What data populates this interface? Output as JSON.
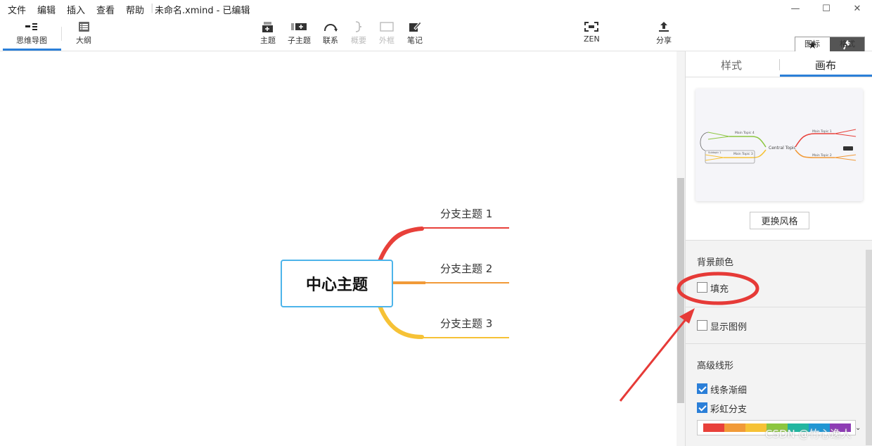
{
  "menubar": {
    "items": [
      "文件",
      "编辑",
      "插入",
      "查看",
      "帮助"
    ],
    "title": "未命名.xmind - 已编辑"
  },
  "window_controls": {
    "minimize": "—",
    "maximize": "☐",
    "close": "✕"
  },
  "toolbar": {
    "mindmap_label": "思维导图",
    "outline_label": "大纲",
    "topic_label": "主题",
    "subtopic_label": "子主题",
    "relation_label": "联系",
    "summary_label": "概要",
    "boundary_label": "外框",
    "note_label": "笔记",
    "zen_label": "ZEN",
    "share_label": "分享",
    "icon_label": "图标",
    "format_label": "格式"
  },
  "mindmap": {
    "central": "中心主题",
    "branches": [
      {
        "label": "分支主题 1",
        "color": "#e8403a"
      },
      {
        "label": "分支主题 2",
        "color": "#f19a38"
      },
      {
        "label": "分支主题 3",
        "color": "#f6c236"
      }
    ]
  },
  "panel": {
    "tabs": [
      "样式",
      "画布"
    ],
    "active_tab": "画布",
    "preview": {
      "central": "Central Topic",
      "main_topics": [
        "Main Topic 1",
        "Main Topic 2",
        "Main Topic 3",
        "Main Topic 4"
      ],
      "subtopic": "Subtopic 1"
    },
    "change_style_button": "更换风格",
    "bg_section_title": "背景颜色",
    "fill_label": "填充",
    "fill_checked": false,
    "legend_label": "显示图例",
    "legend_checked": false,
    "advanced_title": "高级线形",
    "taper_label": "线条渐细",
    "taper_checked": true,
    "rainbow_label": "彩虹分支",
    "rainbow_checked": true,
    "palette": [
      "#e8403a",
      "#f19a38",
      "#f6c236",
      "#8cc63f",
      "#22b6a0",
      "#2196d3",
      "#8e3db4"
    ]
  },
  "annotation": {
    "ellipse_color": "#e63a37"
  },
  "watermark": "CSDN @竹心逸人"
}
